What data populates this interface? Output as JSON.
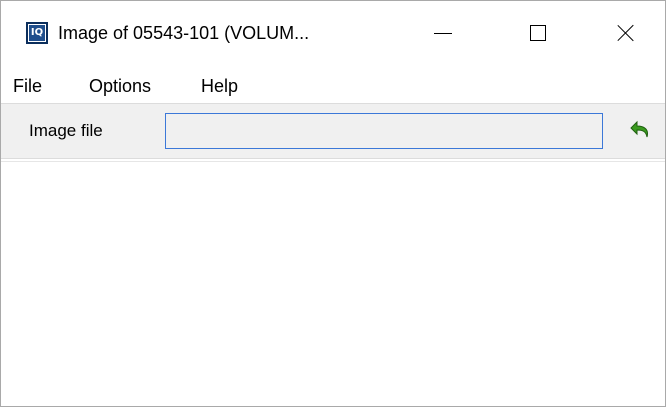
{
  "window": {
    "title": "Image of 05543-101 (VOLUM...",
    "app_icon_text": "IQ",
    "icons": {
      "app": "iq-app-icon",
      "minimize": "minimize-icon",
      "maximize": "maximize-icon",
      "close": "close-icon"
    }
  },
  "menubar": {
    "items": [
      {
        "label": "File"
      },
      {
        "label": "Options"
      },
      {
        "label": "Help"
      }
    ]
  },
  "toolbar": {
    "image_file_label": "Image file",
    "image_file_value": "",
    "undo_icon": "undo-arrow-icon",
    "accent_color": "#3c78d8",
    "undo_color": "#3a9a1f"
  }
}
